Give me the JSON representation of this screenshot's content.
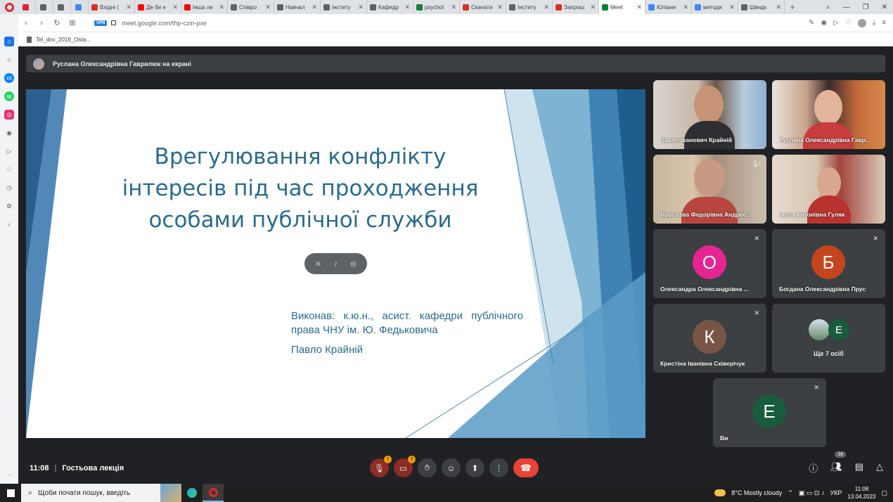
{
  "browser": {
    "tabs": [
      {
        "label": "",
        "color": "#e0262d",
        "pinned": true
      },
      {
        "label": "",
        "color": "#5f6368",
        "pinned": true
      },
      {
        "label": "",
        "color": "#5f6368",
        "pinned": true
      },
      {
        "label": "",
        "color": "#4285f4",
        "pinned": true
      },
      {
        "label": "Вхідні (",
        "color": "#d93025"
      },
      {
        "label": "Де би н",
        "color": "#ff0000"
      },
      {
        "label": "Інша ле",
        "color": "#ff0000"
      },
      {
        "label": "Співро",
        "color": "#5f6368"
      },
      {
        "label": "Навчал",
        "color": "#5f6368"
      },
      {
        "label": "Інститу",
        "color": "#5f6368"
      },
      {
        "label": "Кафедр",
        "color": "#5f6368"
      },
      {
        "label": "psychol",
        "color": "#188038"
      },
      {
        "label": "Скачати",
        "color": "#d93025"
      },
      {
        "label": "Інститу",
        "color": "#5f6368"
      },
      {
        "label": "Запрош",
        "color": "#d93025"
      },
      {
        "label": "Meet",
        "color": "#00832d",
        "active": true
      },
      {
        "label": "Юліанн",
        "color": "#4285f4"
      },
      {
        "label": "методи",
        "color": "#4285f4"
      },
      {
        "label": "Швидк",
        "color": "#5f6368"
      }
    ],
    "new_tab": "+",
    "url": "meet.google.com/thp-czin-pxe",
    "vpn_label": "VPN",
    "bookmark": "Tel_dov_2019_Osta..."
  },
  "meet": {
    "presenter_banner": "Руслана Олександрівна Гаврилюк на екрані",
    "slide": {
      "title_lines": [
        "Врегулювання конфлікту",
        "інтересів під час проходження",
        "особами публічної служби"
      ],
      "author_text": "Виконав: к.ю.н., асист. кафедри публічного права ЧНУ ім. Ю. Федьковича",
      "author_name": "Павло Крайній"
    },
    "participants": [
      {
        "name": "Павло Іванович Крайній",
        "type": "video"
      },
      {
        "name": "Руслана Олександрівна Гавр...",
        "type": "video"
      },
      {
        "name": "Ярослава Федорівна Андрее...",
        "type": "video",
        "muted": true
      },
      {
        "name": "Інеса Антонівна Гуляк",
        "type": "video"
      },
      {
        "name": "Олександра Олександрівна ...",
        "initial": "О",
        "color": "#e52592",
        "muted": true
      },
      {
        "name": "Богдана Олександрівна Прус",
        "initial": "Б",
        "color": "#c5451f",
        "muted": true
      },
      {
        "name": "Кристіна Іванівна Сківерічук",
        "initial": "К",
        "color": "#795548",
        "muted": true
      },
      {
        "name": "Ще 7 осіб",
        "type": "more",
        "initial": "Е"
      },
      {
        "name": "Ви",
        "initial": "Е",
        "color": "#185c3c",
        "muted": true
      }
    ],
    "bottom": {
      "time": "11:08",
      "meeting_name": "Гостьова лекція",
      "people_count": "16",
      "mic_warning": "!",
      "cam_warning": "!"
    }
  },
  "taskbar": {
    "search_placeholder": "Щоби почати пошук, введіть",
    "weather": "8°C  Mostly cloudy",
    "language": "УКР",
    "time": "11:08",
    "date": "13.04.2023"
  }
}
